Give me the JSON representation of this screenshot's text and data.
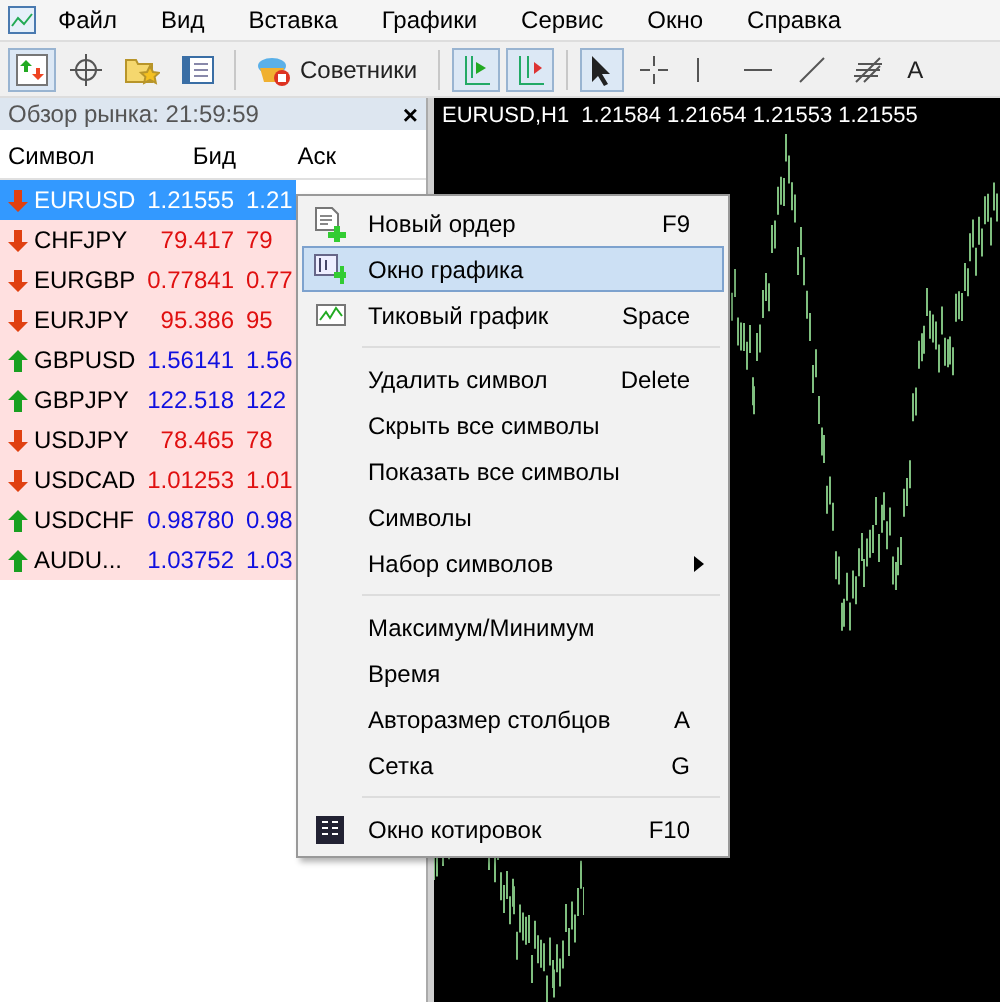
{
  "menubar": [
    "Файл",
    "Вид",
    "Вставка",
    "Графики",
    "Сервис",
    "Окно",
    "Справка"
  ],
  "toolbar": {
    "experts_label": "Советники",
    "text_tool": "A"
  },
  "market_watch": {
    "title": "Обзор рынка: 21:59:59",
    "close": "×",
    "columns": [
      "Символ",
      "Бид",
      "Аск"
    ],
    "rows": [
      {
        "symbol": "EURUSD",
        "bid": "1.21555",
        "ask": "1.21",
        "rising": false,
        "selected": true
      },
      {
        "symbol": "CHFJPY",
        "bid": "79.417",
        "ask": "79",
        "rising": false,
        "selected": false
      },
      {
        "symbol": "EURGBP",
        "bid": "0.77841",
        "ask": "0.77",
        "rising": false,
        "selected": false
      },
      {
        "symbol": "EURJPY",
        "bid": "95.386",
        "ask": "95",
        "rising": false,
        "selected": false
      },
      {
        "symbol": "GBPUSD",
        "bid": "1.56141",
        "ask": "1.56",
        "rising": true,
        "selected": false
      },
      {
        "symbol": "GBPJPY",
        "bid": "122.518",
        "ask": "122",
        "rising": true,
        "selected": false
      },
      {
        "symbol": "USDJPY",
        "bid": "78.465",
        "ask": "78",
        "rising": false,
        "selected": false
      },
      {
        "symbol": "USDCAD",
        "bid": "1.01253",
        "ask": "1.01",
        "rising": false,
        "selected": false
      },
      {
        "symbol": "USDCHF",
        "bid": "0.98780",
        "ask": "0.98",
        "rising": true,
        "selected": false
      },
      {
        "symbol": "AUDU...",
        "bid": "1.03752",
        "ask": "1.03",
        "rising": true,
        "selected": false
      }
    ]
  },
  "chart": {
    "title": "EURUSD,H1  1.21584 1.21654 1.21553 1.21555"
  },
  "context_menu": [
    {
      "kind": "order",
      "label": "Новый ордер",
      "shortcut": "F9",
      "selected": false,
      "submenu": false
    },
    {
      "kind": "chart",
      "label": "Окно графика",
      "selected": true,
      "submenu": false
    },
    {
      "kind": "tick",
      "label": "Тиковый график",
      "shortcut": "Space",
      "selected": false,
      "submenu": false
    },
    {
      "kind": "separator"
    },
    {
      "kind": "plain",
      "label": "Удалить символ",
      "shortcut": "Delete",
      "selected": false,
      "submenu": false
    },
    {
      "kind": "plain",
      "label": "Скрыть все символы",
      "selected": false,
      "submenu": false
    },
    {
      "kind": "plain",
      "label": "Показать все символы",
      "selected": false,
      "submenu": false
    },
    {
      "kind": "plain",
      "label": "Символы",
      "selected": false,
      "submenu": false
    },
    {
      "kind": "plain",
      "label": "Набор символов",
      "selected": false,
      "submenu": true
    },
    {
      "kind": "separator"
    },
    {
      "kind": "plain",
      "label": "Максимум/Минимум",
      "selected": false,
      "submenu": false
    },
    {
      "kind": "plain",
      "label": "Время",
      "selected": false,
      "submenu": false
    },
    {
      "kind": "plain",
      "label": "Авторазмер столбцов",
      "shortcut": "A",
      "selected": false,
      "submenu": false
    },
    {
      "kind": "plain",
      "label": "Сетка",
      "shortcut": "G",
      "selected": false,
      "submenu": false
    },
    {
      "kind": "separator"
    },
    {
      "kind": "quotes",
      "label": "Окно котировок",
      "shortcut": "F10",
      "selected": false,
      "submenu": false
    }
  ]
}
